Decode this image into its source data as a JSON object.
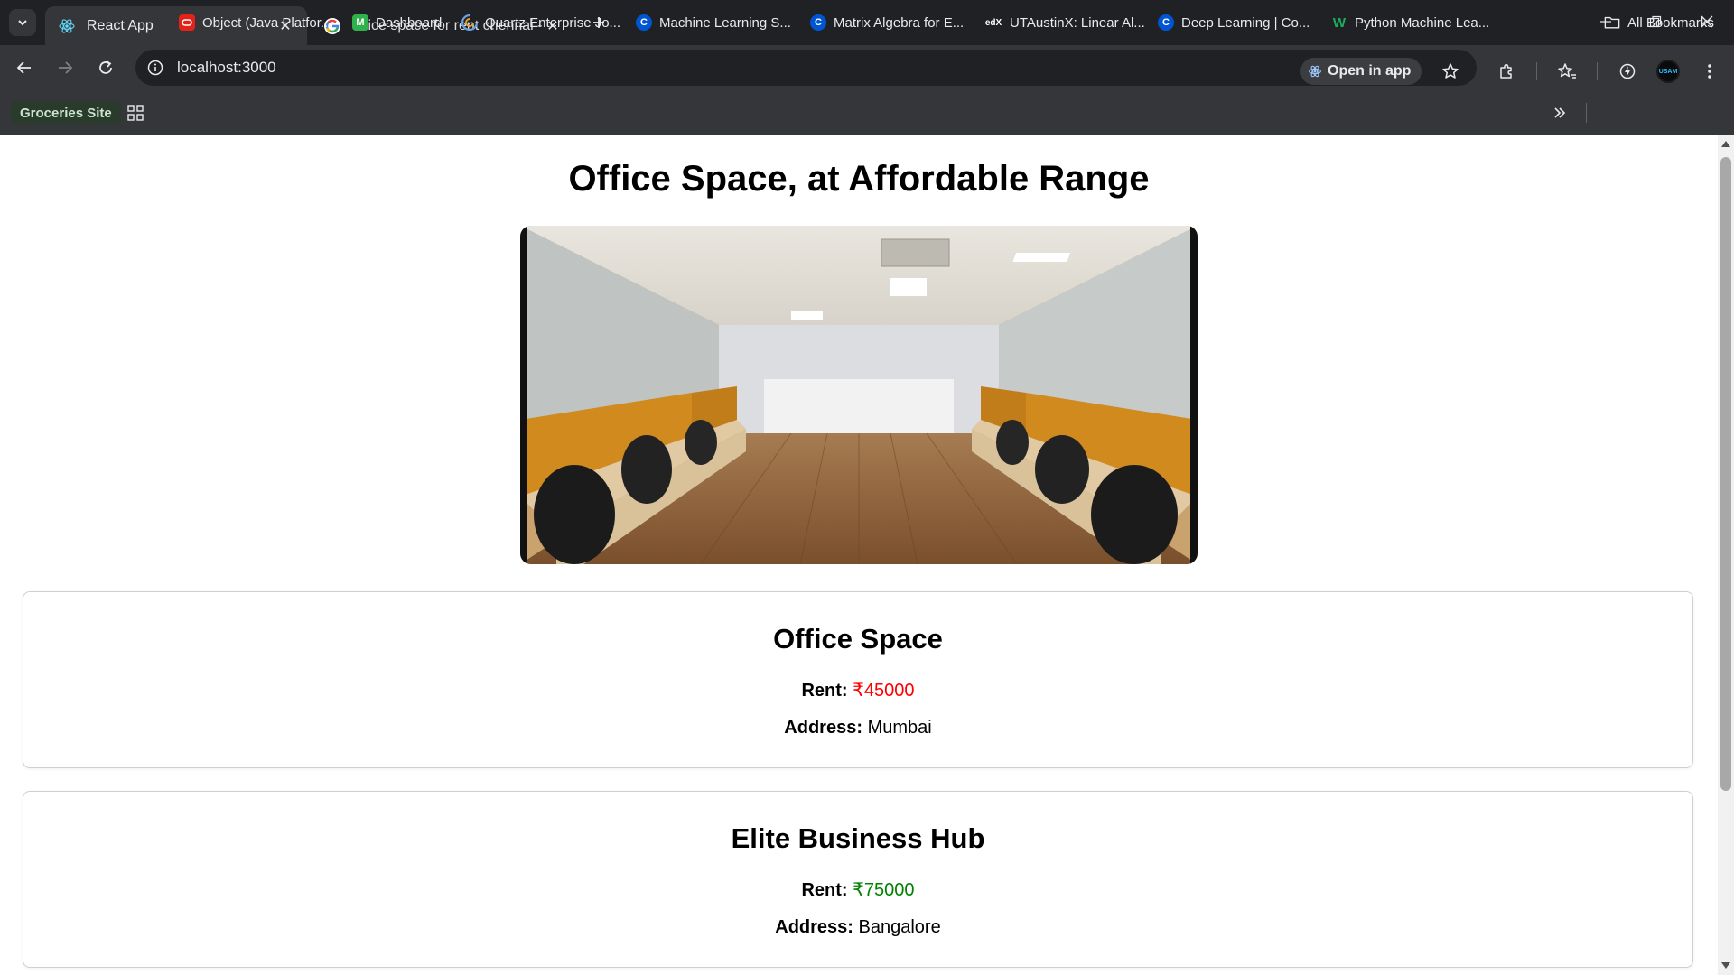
{
  "browser": {
    "tabs": [
      {
        "title": "React App",
        "active": true,
        "icon": "react-icon"
      },
      {
        "title": "office space for rent chennai - Goo",
        "active": false,
        "icon": "google-icon"
      }
    ],
    "url": "localhost:3000",
    "open_in_app_label": "Open in app",
    "avatar_text": "USAM",
    "bookmarks": {
      "groceries_label": "Groceries Site",
      "items": [
        {
          "label": "Object (Java Platfor...",
          "icon": "oracle-icon",
          "color": "#e2231a"
        },
        {
          "label": "Dashboard",
          "icon": "m-icon",
          "color": "#2fb24c"
        },
        {
          "label": "Quartz Enterprise Jo...",
          "icon": "quartz-icon",
          "color": "#6aa0e0"
        },
        {
          "label": "Machine Learning S...",
          "icon": "coursera-icon",
          "color": "#0056d2"
        },
        {
          "label": "Matrix Algebra for E...",
          "icon": "coursera-icon",
          "color": "#0056d2"
        },
        {
          "label": "UTAustinX: Linear Al...",
          "icon": "edx-icon",
          "color": "#ffffff"
        },
        {
          "label": "Deep Learning | Co...",
          "icon": "coursera-icon",
          "color": "#0056d2"
        },
        {
          "label": "Python Machine Lea...",
          "icon": "w-icon",
          "color": "#1aaf5d"
        }
      ],
      "all_bookmarks_label": "All Bookmarks"
    }
  },
  "page": {
    "title": "Office Space, at Affordable Range",
    "listings": [
      {
        "name": "Office Space",
        "rent_label": "Rent:",
        "rent_value": "₹45000",
        "rent_color": "#ff0000",
        "address_label": "Address:",
        "address_value": "Mumbai"
      },
      {
        "name": "Elite Business Hub",
        "rent_label": "Rent:",
        "rent_value": "₹75000",
        "rent_color": "#008000",
        "address_label": "Address:",
        "address_value": "Bangalore"
      }
    ]
  }
}
